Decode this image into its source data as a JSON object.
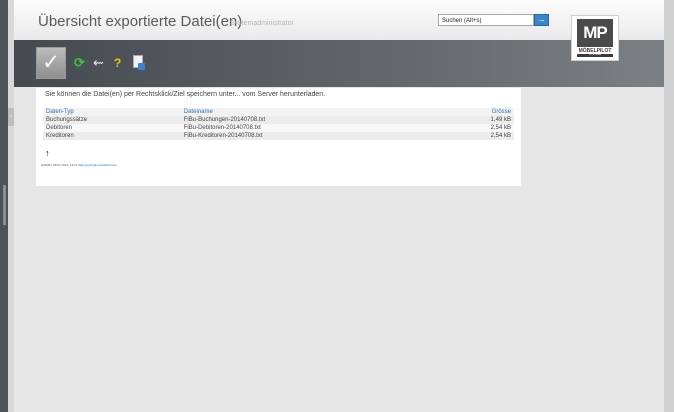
{
  "header": {
    "title": "Übersicht exportierte Datei(en)",
    "subtitle": "Systemadministrator",
    "search_placeholder": "Suchen (Alt+s)",
    "search_button": "→"
  },
  "logo": {
    "mark": "MP",
    "name": "MÖBELPILOT",
    "tag": "BY SCHEMA"
  },
  "toolbar": {
    "check_label": "✓",
    "refresh_icon": "⟳",
    "back_icon": "⇜",
    "help_icon": "?"
  },
  "main": {
    "info_text": "Sie können die Datei(en) per Rechtsklick/Ziel speichern unter... vom Server herunterladen.",
    "columns": [
      "Daten-Typ",
      "Dateiname",
      "Grösse"
    ],
    "rows": [
      [
        "Buchungssätze",
        "FiBu-Buchungen-20140708.txt",
        "1,49 kB"
      ],
      [
        "Debitoren",
        "FiBu-Debitoren-20140708.txt",
        "2,54 kB"
      ],
      [
        "Kreditoren",
        "FiBu-Kreditoren-20140708.txt",
        "2,54 kB"
      ]
    ],
    "up_arrow": "↑",
    "footer_prefix": "[ADMIN, 08.07.2014, 14:27:31]",
    "footer_link": "[support@moebelpilot.de]"
  },
  "side": {
    "arrow": "›"
  }
}
